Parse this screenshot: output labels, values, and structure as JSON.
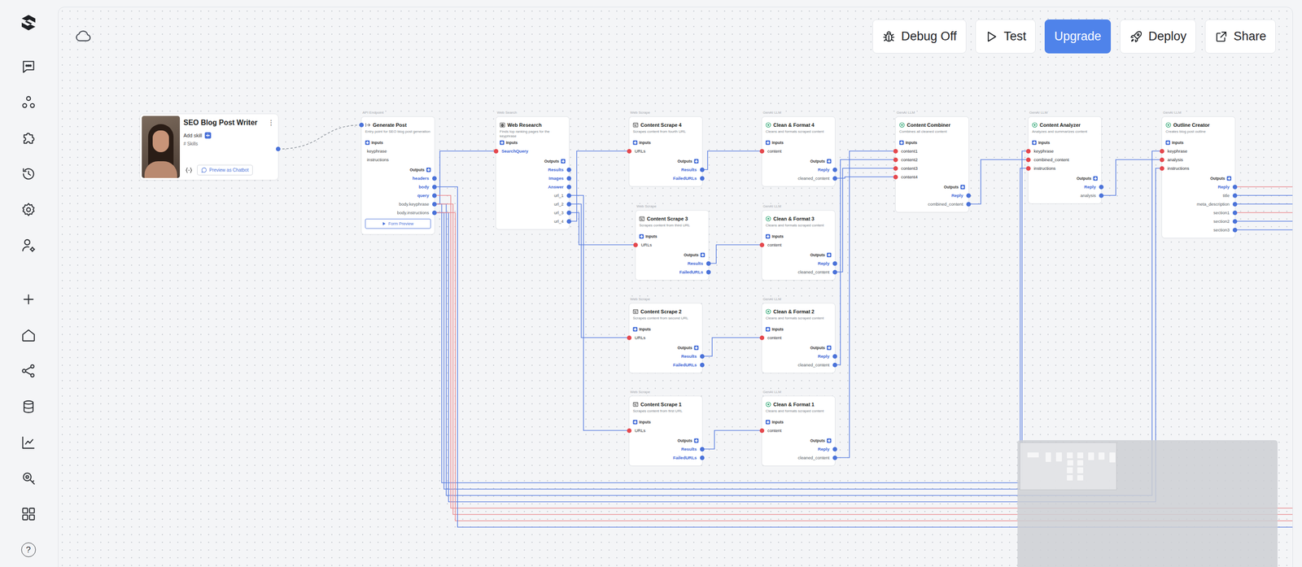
{
  "toolbar": {
    "debug": {
      "label": "Debug Off"
    },
    "test": {
      "label": "Test"
    },
    "upgrade": {
      "label": "Upgrade"
    },
    "deploy": {
      "label": "Deploy"
    },
    "share": {
      "label": "Share"
    }
  },
  "sidebar": {
    "help": "?"
  },
  "agent": {
    "name": "SEO Blog Post Writer",
    "menu": "⋮",
    "add_skill": "Add skill",
    "skills": "# Skills",
    "preview": "Preview as Chatbot"
  },
  "port_labels": {
    "inputs": "Inputs",
    "outputs": "Outputs"
  },
  "nodes": [
    {
      "kind": "endpoint",
      "category": "API Endpoint",
      "title": "Generate Post",
      "description": "Entry point for SEO blog post generation",
      "inputs": [
        {
          "name": "keyphrase",
          "kind": "field"
        },
        {
          "name": "instructions",
          "kind": "field"
        }
      ],
      "outputs": [
        {
          "name": "headers",
          "kind": "builtin"
        },
        {
          "name": "body",
          "kind": "builtin"
        },
        {
          "name": "query",
          "kind": "builtin"
        },
        {
          "name": "body.keyphrase",
          "kind": "custom"
        },
        {
          "name": "body.instructions",
          "kind": "custom"
        }
      ],
      "button": "Form Preview"
    },
    {
      "kind": "search",
      "category": "Web Search",
      "title": "Web Research",
      "description": "Finds top ranking pages for the keyphrase",
      "inputs": [
        {
          "name": "SearchQuery",
          "kind": "builtin"
        }
      ],
      "outputs": [
        {
          "name": "Results",
          "kind": "builtin"
        },
        {
          "name": "Images",
          "kind": "builtin"
        },
        {
          "name": "Answer",
          "kind": "builtin"
        },
        {
          "name": "url_1",
          "kind": "custom"
        },
        {
          "name": "url_2",
          "kind": "custom"
        },
        {
          "name": "url_3",
          "kind": "custom"
        },
        {
          "name": "url_4",
          "kind": "custom"
        }
      ]
    },
    {
      "kind": "scrape",
      "category": "Web Scrape",
      "title": "Content Scrape 4",
      "description": "Scrapes content from fourth URL",
      "inputs": [
        {
          "name": "URLs",
          "kind": "port"
        }
      ],
      "outputs": [
        {
          "name": "Results",
          "kind": "builtin"
        },
        {
          "name": "FailedURLs",
          "kind": "builtin"
        }
      ]
    },
    {
      "kind": "llm",
      "category": "GenAI LLM",
      "title": "Clean & Format 4",
      "description": "Cleans and formats scraped content",
      "inputs": [
        {
          "name": "content",
          "kind": "port"
        }
      ],
      "outputs": [
        {
          "name": "Reply",
          "kind": "builtin"
        },
        {
          "name": "cleaned_content",
          "kind": "custom"
        }
      ]
    },
    {
      "kind": "llm",
      "category": "GenAI LLM",
      "title": "Content Combiner",
      "description": "Combines all cleaned content",
      "inputs": [
        {
          "name": "content1",
          "kind": "port"
        },
        {
          "name": "content2",
          "kind": "port"
        },
        {
          "name": "content3",
          "kind": "port"
        },
        {
          "name": "content4",
          "kind": "port"
        }
      ],
      "outputs": [
        {
          "name": "Reply",
          "kind": "builtin"
        },
        {
          "name": "combined_content",
          "kind": "custom"
        }
      ]
    },
    {
      "kind": "llm",
      "category": "GenAI LLM",
      "title": "Content Analyzer",
      "description": "Analyzes and summarizes content",
      "inputs": [
        {
          "name": "keyphrase",
          "kind": "port"
        },
        {
          "name": "combined_content",
          "kind": "port"
        },
        {
          "name": "instructions",
          "kind": "port"
        }
      ],
      "outputs": [
        {
          "name": "Reply",
          "kind": "builtin"
        },
        {
          "name": "analysis",
          "kind": "custom"
        }
      ]
    },
    {
      "kind": "llm",
      "category": "GenAI LLM",
      "title": "Outline Creator",
      "description": "Creates blog post outline",
      "inputs": [
        {
          "name": "keyphrase",
          "kind": "port"
        },
        {
          "name": "analysis",
          "kind": "port"
        },
        {
          "name": "instructions",
          "kind": "port"
        }
      ],
      "outputs": [
        {
          "name": "Reply",
          "kind": "builtin"
        },
        {
          "name": "title",
          "kind": "custom"
        },
        {
          "name": "meta_description",
          "kind": "custom"
        },
        {
          "name": "section1",
          "kind": "custom"
        },
        {
          "name": "section2",
          "kind": "custom"
        },
        {
          "name": "section3",
          "kind": "custom"
        }
      ]
    },
    {
      "kind": "scrape",
      "category": "Web Scrape",
      "title": "Content Scrape 3",
      "description": "Scrapes content from third URL",
      "inputs": [
        {
          "name": "URLs",
          "kind": "port"
        }
      ],
      "outputs": [
        {
          "name": "Results",
          "kind": "builtin"
        },
        {
          "name": "FailedURLs",
          "kind": "builtin"
        }
      ]
    },
    {
      "kind": "llm",
      "category": "GenAI LLM",
      "title": "Clean & Format 3",
      "description": "Cleans and formats scraped content",
      "inputs": [
        {
          "name": "content",
          "kind": "port"
        }
      ],
      "outputs": [
        {
          "name": "Reply",
          "kind": "builtin"
        },
        {
          "name": "cleaned_content",
          "kind": "custom"
        }
      ]
    },
    {
      "kind": "scrape",
      "category": "Web Scrape",
      "title": "Content Scrape 2",
      "description": "Scrapes content from second URL",
      "inputs": [
        {
          "name": "URLs",
          "kind": "port"
        }
      ],
      "outputs": [
        {
          "name": "Results",
          "kind": "builtin"
        },
        {
          "name": "FailedURLs",
          "kind": "builtin"
        }
      ]
    },
    {
      "kind": "llm",
      "category": "GenAI LLM",
      "title": "Clean & Format 2",
      "description": "Cleans and formats scraped content",
      "inputs": [
        {
          "name": "content",
          "kind": "port"
        }
      ],
      "outputs": [
        {
          "name": "Reply",
          "kind": "builtin"
        },
        {
          "name": "cleaned_content",
          "kind": "custom"
        }
      ]
    },
    {
      "kind": "scrape",
      "category": "Web Scrape",
      "title": "Content Scrape 1",
      "description": "Scrapes content from first URL",
      "inputs": [
        {
          "name": "URLs",
          "kind": "port"
        }
      ],
      "outputs": [
        {
          "name": "Results",
          "kind": "builtin"
        },
        {
          "name": "FailedURLs",
          "kind": "builtin"
        }
      ]
    },
    {
      "kind": "llm",
      "category": "GenAI LLM",
      "title": "Clean & Format 1",
      "description": "Cleans and formats scraped content",
      "inputs": [
        {
          "name": "content",
          "kind": "port"
        }
      ],
      "outputs": [
        {
          "name": "Reply",
          "kind": "builtin"
        },
        {
          "name": "cleaned_content",
          "kind": "custom"
        }
      ]
    }
  ],
  "edges": [
    {
      "from": "Generate Post.body.keyphrase",
      "to": "Web Research.SearchQuery",
      "color": "#5b7fe0"
    },
    {
      "from": "Web Research.url_4",
      "to": "Content Scrape 4.URLs",
      "color": "#5b7fe0"
    },
    {
      "from": "Web Research.url_3",
      "to": "Content Scrape 3.URLs",
      "color": "#5b7fe0"
    },
    {
      "from": "Web Research.url_2",
      "to": "Content Scrape 2.URLs",
      "color": "#5b7fe0"
    },
    {
      "from": "Web Research.url_1",
      "to": "Content Scrape 1.URLs",
      "color": "#5b7fe0"
    },
    {
      "from": "Content Scrape 4.Results",
      "to": "Clean & Format 4.content",
      "color": "#5b7fe0"
    },
    {
      "from": "Content Scrape 3.Results",
      "to": "Clean & Format 3.content",
      "color": "#5b7fe0"
    },
    {
      "from": "Content Scrape 2.Results",
      "to": "Clean & Format 2.content",
      "color": "#5b7fe0"
    },
    {
      "from": "Content Scrape 1.Results",
      "to": "Clean & Format 1.content",
      "color": "#5b7fe0"
    },
    {
      "from": "Clean & Format 1.cleaned_content",
      "to": "Content Combiner.content1",
      "color": "#5b7fe0"
    },
    {
      "from": "Clean & Format 2.cleaned_content",
      "to": "Content Combiner.content2",
      "color": "#5b7fe0"
    },
    {
      "from": "Clean & Format 3.cleaned_content",
      "to": "Content Combiner.content3",
      "color": "#5b7fe0"
    },
    {
      "from": "Clean & Format 4.cleaned_content",
      "to": "Content Combiner.content4",
      "color": "#5b7fe0"
    },
    {
      "from": "Content Combiner.combined_content",
      "to": "Content Analyzer.combined_content",
      "color": "#5b7fe0"
    },
    {
      "from": "Content Analyzer.analysis",
      "to": "Outline Creator.analysis",
      "color": "#5b7fe0"
    },
    {
      "from": "Generate Post.body.keyphrase",
      "to": "Content Analyzer.keyphrase",
      "color": "#5b7fe0"
    },
    {
      "from": "Generate Post.body.instructions",
      "to": "Content Analyzer.instructions",
      "color": "#5b7fe0"
    },
    {
      "from": "Generate Post.body.keyphrase",
      "to": "Outline Creator.keyphrase",
      "color": "#5b7fe0"
    },
    {
      "from": "Generate Post.body.instructions",
      "to": "Outline Creator.instructions",
      "color": "#5b7fe0"
    },
    {
      "from": "Generate Post.query",
      "to": null,
      "color": "#e98a8f"
    },
    {
      "from": "Generate Post.body.keyphrase",
      "to": null,
      "color": "#e98a8f"
    },
    {
      "from": "Generate Post.body.instructions",
      "to": null,
      "color": "#e98a8f"
    },
    {
      "from": "Generate Post.body",
      "to": null,
      "color": "#5b7fe0"
    },
    {
      "from": "Outline Creator.Reply",
      "to": null,
      "color": "#e98a8f"
    },
    {
      "from": "Outline Creator.title",
      "to": null,
      "color": "#5b7fe0"
    },
    {
      "from": "Outline Creator.meta_description",
      "to": null,
      "color": "#5b7fe0"
    },
    {
      "from": "Outline Creator.section1",
      "to": null,
      "color": "#e98a8f"
    },
    {
      "from": "Outline Creator.section2",
      "to": null,
      "color": "#5b7fe0"
    },
    {
      "from": "Outline Creator.section3",
      "to": null,
      "color": "#5b7fe0"
    }
  ]
}
